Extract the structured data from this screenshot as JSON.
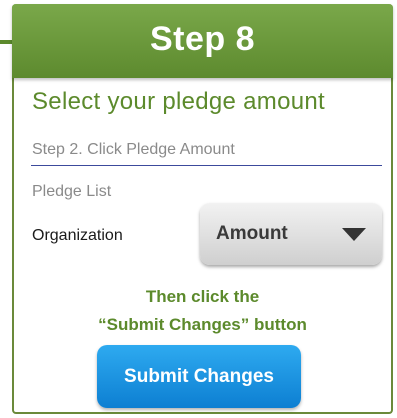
{
  "header": {
    "title": "Step 8"
  },
  "form": {
    "subtitle": "Select your pledge amount",
    "instruction": "Step 2. Click Pledge Amount",
    "section_label": "Pledge List",
    "organization_label": "Organization",
    "amount_dropdown": {
      "selected": "Amount"
    },
    "hint_line1": "Then click the",
    "hint_line2": "“Submit Changes” button",
    "submit_label": "Submit Changes"
  },
  "colors": {
    "brand_green": "#5c8a2c",
    "button_blue": "#1390dd",
    "underline_blue": "#3c4a9c"
  }
}
